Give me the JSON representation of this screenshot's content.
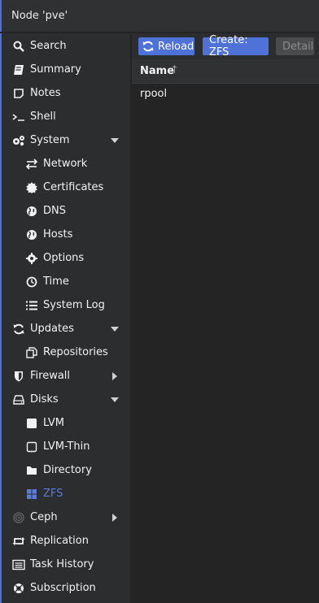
{
  "window": {
    "title": "Node 'pve'"
  },
  "sidebar": {
    "items": [
      {
        "label": "Search",
        "icon": "search-icon"
      },
      {
        "label": "Summary",
        "icon": "book-icon"
      },
      {
        "label": "Notes",
        "icon": "note-icon"
      },
      {
        "label": "Shell",
        "icon": "terminal-icon"
      },
      {
        "label": "System",
        "icon": "cogs-icon",
        "expanded": true
      },
      {
        "label": "Network",
        "icon": "exchange-icon"
      },
      {
        "label": "Certificates",
        "icon": "certificate-icon"
      },
      {
        "label": "DNS",
        "icon": "globe-icon"
      },
      {
        "label": "Hosts",
        "icon": "globe-icon"
      },
      {
        "label": "Options",
        "icon": "gear-icon"
      },
      {
        "label": "Time",
        "icon": "clock-icon"
      },
      {
        "label": "System Log",
        "icon": "list-icon"
      },
      {
        "label": "Updates",
        "icon": "refresh-icon",
        "expanded": true
      },
      {
        "label": "Repositories",
        "icon": "files-icon"
      },
      {
        "label": "Firewall",
        "icon": "shield-icon",
        "expanded": false
      },
      {
        "label": "Disks",
        "icon": "hdd-icon",
        "expanded": true
      },
      {
        "label": "LVM",
        "icon": "square-icon"
      },
      {
        "label": "LVM-Thin",
        "icon": "square-outline-icon"
      },
      {
        "label": "Directory",
        "icon": "folder-icon"
      },
      {
        "label": "ZFS",
        "icon": "th-large-icon",
        "selected": true
      },
      {
        "label": "Ceph",
        "icon": "ceph-icon",
        "expanded": false
      },
      {
        "label": "Replication",
        "icon": "retweet-icon"
      },
      {
        "label": "Task History",
        "icon": "list-alt-icon"
      },
      {
        "label": "Subscription",
        "icon": "support-icon"
      }
    ]
  },
  "toolbar": {
    "reload_label": "Reload",
    "create_label": "Create: ZFS",
    "detail_label": "Detail"
  },
  "grid": {
    "columns": [
      {
        "label": "Name",
        "sort": "↑"
      }
    ],
    "rows": [
      {
        "name": "rpool"
      }
    ]
  },
  "colors": {
    "accent": "#4e72d8",
    "selected_text": "#5b7bd8",
    "sidebar_bg": "#2c2d2f",
    "main_bg": "#242424"
  }
}
